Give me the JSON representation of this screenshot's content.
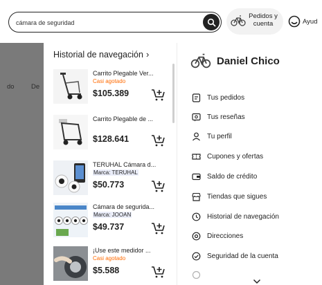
{
  "search": {
    "value": "cámara de seguridad"
  },
  "header": {
    "orders_label_line1": "Pedidos y",
    "orders_label_line2": "cuenta",
    "help_label": "Ayud"
  },
  "background": {
    "nav_1": "do",
    "nav_2": "De"
  },
  "history": {
    "title": "Historial de navegación",
    "items": [
      {
        "title": "Carrito Plegable Ver...",
        "badge": "Casi agotado",
        "brand": "",
        "price": "$105.389"
      },
      {
        "title": "Carrito Plegable de ...",
        "badge": "",
        "brand": "",
        "price": "$128.641"
      },
      {
        "title": "TERUHAL Cámara d...",
        "badge": "",
        "brand": "Marca: TERUHAL",
        "price": "$50.773"
      },
      {
        "title": "Cámara de segurida...",
        "badge": "",
        "brand": "Marca: JOOAN",
        "price": "$49.737"
      },
      {
        "title": "¡Use este medidor ...",
        "badge": "Casi agotado",
        "brand": "",
        "price": "$5.588"
      }
    ]
  },
  "account": {
    "name": "Daniel Chico",
    "menu": [
      {
        "label": "Tus pedidos",
        "icon": "orders-icon"
      },
      {
        "label": "Tus reseñas",
        "icon": "reviews-icon"
      },
      {
        "label": "Tu perfil",
        "icon": "profile-icon"
      },
      {
        "label": "Cupones y ofertas",
        "icon": "coupon-icon"
      },
      {
        "label": "Saldo de crédito",
        "icon": "credit-icon"
      },
      {
        "label": "Tiendas que sigues",
        "icon": "store-icon"
      },
      {
        "label": "Historial de navegación",
        "icon": "history-icon"
      },
      {
        "label": "Direcciones",
        "icon": "address-icon"
      },
      {
        "label": "Seguridad de la cuenta",
        "icon": "security-icon"
      }
    ]
  },
  "colors": {
    "badge": "#ff6a00",
    "brand_bg": "#ebeefa",
    "text": "#222222",
    "overlay": "#7a7a7a"
  }
}
